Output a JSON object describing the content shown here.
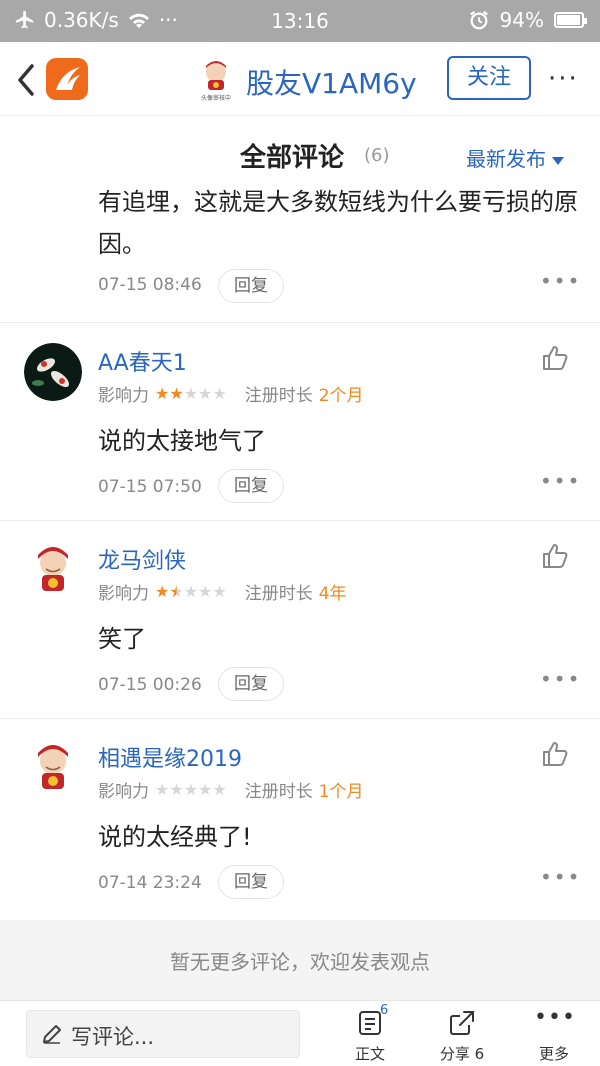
{
  "status_bar": {
    "speed": "0.36K/s",
    "time": "13:16",
    "battery": "94%",
    "battery_level": 0.94
  },
  "header": {
    "avatar_caption": "头像审核中",
    "user_name": "股友V1AM6y",
    "follow_label": "关注",
    "more_label": "···"
  },
  "section": {
    "title": "全部评论",
    "count": "(6)",
    "sort_label": "最新发布"
  },
  "partial_comment": {
    "text": "有追埋，这就是大多数短线为什么要亏损的原因。",
    "time": "07-15 08:46",
    "reply_label": "回复"
  },
  "meta_labels": {
    "influence": "影响力",
    "registered": "注册时长"
  },
  "comments": [
    {
      "name": "AA春天1",
      "influence_stars": 2,
      "registered": "2个月",
      "text": "说的太接地气了",
      "time": "07-15 07:50",
      "reply_label": "回复"
    },
    {
      "name": "龙马剑侠",
      "influence_stars": 1.5,
      "registered": "4年",
      "text": "笑了",
      "time": "07-15 00:26",
      "reply_label": "回复"
    },
    {
      "name": "相遇是缘2019",
      "influence_stars": 0,
      "registered": "1个月",
      "text": "说的太经典了!",
      "time": "07-14 23:24",
      "reply_label": "回复"
    }
  ],
  "end_note": "暂无更多评论，欢迎发表观点",
  "bottom_bar": {
    "write_placeholder": "写评论...",
    "article_label": "正文",
    "article_badge": "6",
    "share_label": "分享 6",
    "more_label": "更多"
  },
  "colors": {
    "accent": "#2a66c0",
    "star_on": "#f08a1c",
    "status_bar": "#a8a8a8",
    "app_logo": "#f06a1c"
  }
}
